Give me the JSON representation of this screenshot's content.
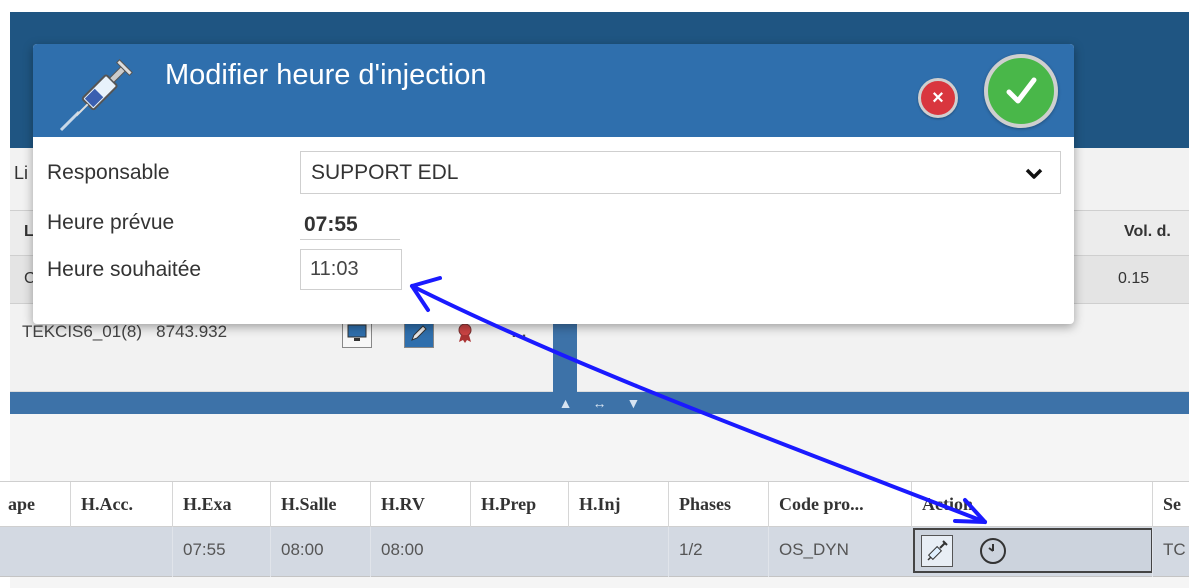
{
  "background": {
    "left_label_fragment": "Li",
    "grid_header": {
      "col_l": "L",
      "col_vol": "Vol. d."
    },
    "grid_row": {
      "col_c": "C",
      "vol": "0.15"
    },
    "exam_code": "TEKCIS6_01(8)",
    "exam_value": "8743.932"
  },
  "modal": {
    "title": "Modifier heure d'injection",
    "cancel_symbol": "×",
    "labels": {
      "responsable": "Responsable",
      "heure_prevue": "Heure prévue",
      "heure_souhaitee": "Heure souhaitée"
    },
    "responsable_value": "SUPPORT EDL",
    "heure_prevue_value": "07:55",
    "heure_souhaitee_value": "11:03"
  },
  "table": {
    "headers": [
      "ape",
      "H.Acc.",
      "H.Exa",
      "H.Salle",
      "H.RV",
      "H.Prep",
      "H.Inj",
      "Phases",
      "Code pro...",
      "Action",
      "Se"
    ],
    "row": [
      "",
      "",
      "07:55",
      "08:00",
      "08:00",
      "",
      "",
      "1/2",
      "OS_DYN",
      "",
      "TC"
    ]
  },
  "colors": {
    "header_blue": "#2f6fad",
    "app_dark_blue": "#1f5582",
    "confirm_green": "#49b749",
    "cancel_red": "#d9363e",
    "annotation_arrow": "#1a1aff"
  }
}
